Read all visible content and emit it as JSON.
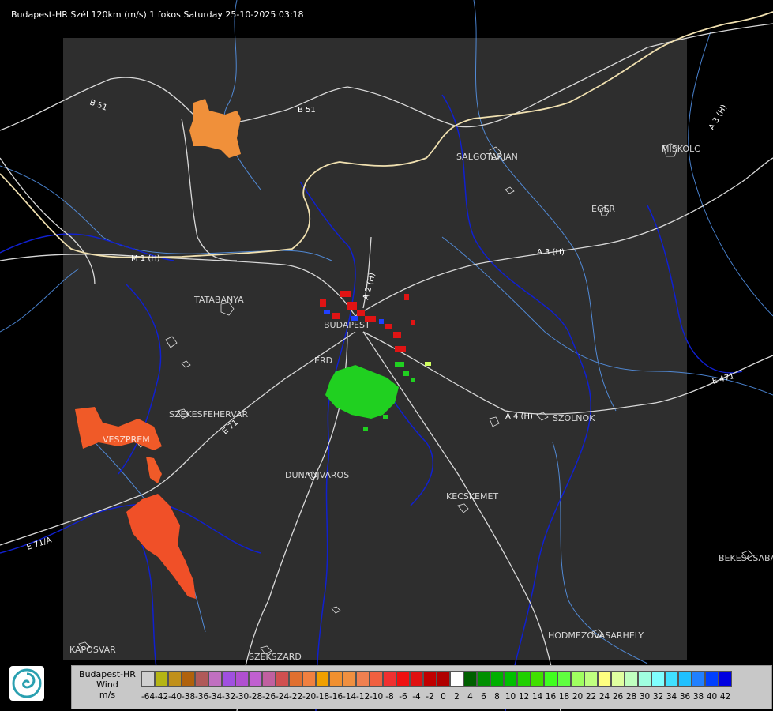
{
  "header": {
    "title": "Budapest-HR Szél 120km (m/s) 1 fokos Saturday 25-10-2025 03:18"
  },
  "cities": [
    {
      "name": "SALGOTARJAN"
    },
    {
      "name": "MISKOLC"
    },
    {
      "name": "EGER"
    },
    {
      "name": "TATABANYA"
    },
    {
      "name": "BUDAPEST"
    },
    {
      "name": "ERD"
    },
    {
      "name": "SZEKESFEHERVAR"
    },
    {
      "name": "VESZPREM"
    },
    {
      "name": "DUNAUJVAROS"
    },
    {
      "name": "KECSKEMET"
    },
    {
      "name": "SZOLNOK"
    },
    {
      "name": "BEKESCSABA"
    },
    {
      "name": "HODMEZOVASARHELY"
    },
    {
      "name": "KAPOSVAR"
    },
    {
      "name": "SZEKSZARD"
    }
  ],
  "roads": [
    {
      "name": "B 51"
    },
    {
      "name": "B 51"
    },
    {
      "name": "A 3 (H)"
    },
    {
      "name": "A 3 (H)"
    },
    {
      "name": "M 1 (H)"
    },
    {
      "name": "A 2 (H)"
    },
    {
      "name": "A 4 (H)"
    },
    {
      "name": "E 71"
    },
    {
      "name": "E 71/A"
    },
    {
      "name": "E 471"
    }
  ],
  "legend": {
    "title_line1": "Budapest-HR",
    "title_line2": "Wind",
    "title_line3": "m/s",
    "ticks": [
      "-64",
      "-42",
      "-40",
      "-38",
      "-36",
      "-34",
      "-32",
      "-30",
      "-28",
      "-26",
      "-24",
      "-22",
      "-20",
      "-18",
      "-16",
      "-14",
      "-12",
      "-10",
      "-8",
      "-6",
      "-4",
      "-2",
      "0",
      "2",
      "4",
      "6",
      "8",
      "10",
      "12",
      "14",
      "16",
      "18",
      "20",
      "22",
      "24",
      "26",
      "28",
      "30",
      "32",
      "34",
      "36",
      "38",
      "40",
      "42"
    ],
    "colors": [
      "#d0d0d0",
      "#b5b514",
      "#c0901a",
      "#b0620c",
      "#b05a5a",
      "#c070c0",
      "#a050e0",
      "#b050d0",
      "#c060d0",
      "#c060a0",
      "#d05050",
      "#e07030",
      "#f08040",
      "#f0a000",
      "#f09030",
      "#f09040",
      "#f08050",
      "#f06040",
      "#f03030",
      "#f01010",
      "#e01010",
      "#c00000",
      "#b00000",
      "#ffffff",
      "#006000",
      "#009000",
      "#00b000",
      "#00c000",
      "#20d000",
      "#40e000",
      "#40ff20",
      "#60ff40",
      "#a0ff60",
      "#c0ff80",
      "#ffff80",
      "#e0ffa0",
      "#c0ffc0",
      "#a0ffe0",
      "#80ffff",
      "#40e0ff",
      "#20c0ff",
      "#2080ff",
      "#0040ff",
      "#0000e0"
    ]
  }
}
